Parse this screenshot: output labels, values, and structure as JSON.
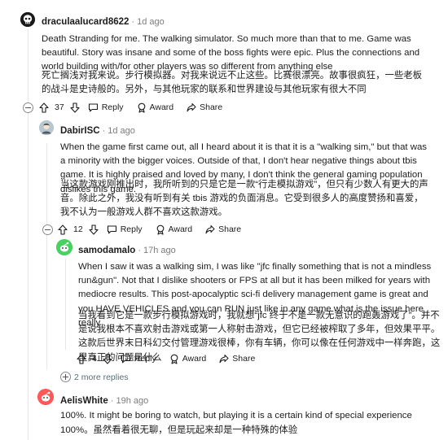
{
  "comments": {
    "c1": {
      "username": "draculaalucard8622",
      "separator": "·",
      "time": "1d ago",
      "text_en": "Death Stranding for me. The walking simulator. So much more than that to me. Game was beautiful. Story was insane and some of the boss fights were epic. Plus the connections and world building with/for other players was so different from anything else",
      "text_cn": "死亡搁浅对我来说。步行模拟器。对我来说远不止这些。比赛很漂亮。故事很疯狂，一些老板的战斗是史诗般的。另外，与其他玩家的联系和世界建设与其他玩家有很大不同",
      "votes": "37",
      "reply_label": "Reply",
      "award_label": "Award",
      "share_label": "Share"
    },
    "c2": {
      "username": "DabirISC",
      "separator": "·",
      "time": "1d ago",
      "text_en": "When the game first came out, all I heard about it is that it is a \"walking sim,\" but that was a minority with the bigger voices. Outside of that, I don't hear negative things about tbis game. It is highly praised and loved by many, I don't think the general gaming population dislikes this game.",
      "text_cn": "当这款游戏刚推出时，我所听到的只是它是一款“行走模拟游戏”，但只有少数人有更大的声音。除此之外，我没有听到有关 tbis 游戏的负面消息。它受到很多人的高度赞扬和喜爱，我不认为一般游戏人群不喜欢这款游戏。",
      "votes": "12",
      "reply_label": "Reply",
      "award_label": "Award",
      "share_label": "Share"
    },
    "c3": {
      "username": "samodamalo",
      "separator": "·",
      "time": "17h ago",
      "text_en": "When I saw it was a walking sim, I was like \"jfc finally something that is not a mindless run&gun\". Not that I dislike shooters or FPS at all but it has been milked for years with mediocre results. This post-apocalyptic sci-fi delivery management game is great and you HAVE VEHICLES and you can RUN just like in any game what is the issue here really",
      "text_cn": "当我看到它是一款步行模拟游戏时，我就想“jfc 终于不是一款无意识的跑轰游戏了”。并不是说我根本不喜欢射击游戏或第一人称射击游戏，但它已经被榨取了多年，但效果平平。这款后世界末日科幻交付管理游戏很棒，你有车辆，你可以像在任何游戏中一样奔跑，这里真正的问题是什么",
      "votes": "4",
      "reply_label": "Reply",
      "award_label": "Award",
      "share_label": "Share"
    },
    "more_replies": "2 more replies",
    "c4": {
      "username": "AelisWhite",
      "separator": "·",
      "time": "19h ago",
      "text_en": "100%. It might be boring to watch, but playing it is a certain kind of special experience",
      "text_cn": "100%。虽然看着很无聊，但是玩起来却是一种特殊的体验"
    }
  },
  "colors": {
    "text": "#1c1c1c",
    "meta": "#7c7c7c",
    "thread_line": "#e5e7e9",
    "avatar_c2_bg": "#b8c7ce",
    "avatar_c3_bg": "#46d160",
    "avatar_c4_bg": "#ff585b"
  },
  "icons": [
    "skull-avatar-icon",
    "collapse-icon",
    "expand-icon",
    "upvote-icon",
    "downvote-icon",
    "reply-icon",
    "award-icon",
    "share-icon"
  ]
}
